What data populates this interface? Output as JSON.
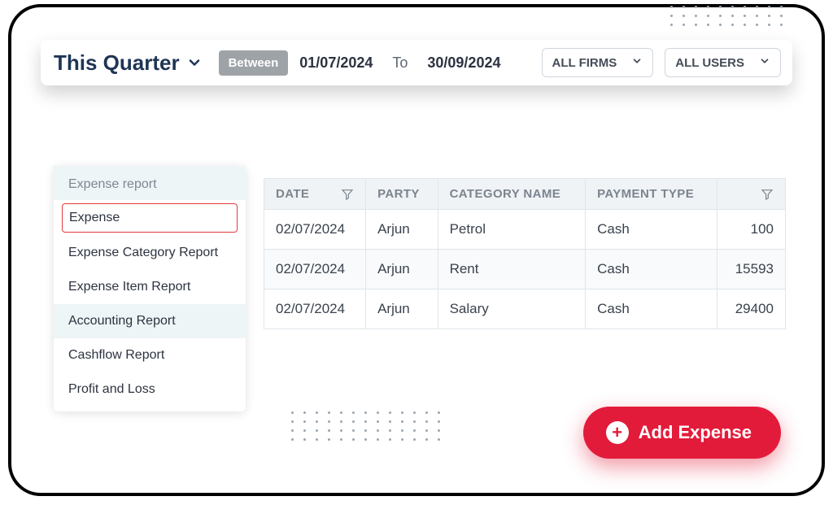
{
  "filters": {
    "period_label": "This Quarter",
    "between_label": "Between",
    "date_from": "01/07/2024",
    "to_label": "To",
    "date_to": "30/09/2024",
    "firms_label": "ALL FIRMS",
    "users_label": "ALL USERS"
  },
  "sidebar": {
    "section1_label": "Expense report",
    "items1": [
      {
        "label": "Expense",
        "active": true
      },
      {
        "label": "Expense Category Report"
      },
      {
        "label": "Expense Item Report"
      }
    ],
    "section2_label": "Accounting Report",
    "items2": [
      {
        "label": "Cashflow Report"
      },
      {
        "label": "Profit and Loss"
      }
    ]
  },
  "table": {
    "headers": {
      "date": "DATE",
      "party": "PARTY",
      "category": "CATEGORY NAME",
      "payment": "PAYMENT TYPE"
    },
    "rows": [
      {
        "date": "02/07/2024",
        "party": "Arjun",
        "category": "Petrol",
        "payment": "Cash",
        "amount": "100"
      },
      {
        "date": "02/07/2024",
        "party": "Arjun",
        "category": "Rent",
        "payment": "Cash",
        "amount": "15593"
      },
      {
        "date": "02/07/2024",
        "party": "Arjun",
        "category": "Salary",
        "payment": "Cash",
        "amount": "29400"
      }
    ]
  },
  "actions": {
    "add_expense": "Add Expense"
  }
}
